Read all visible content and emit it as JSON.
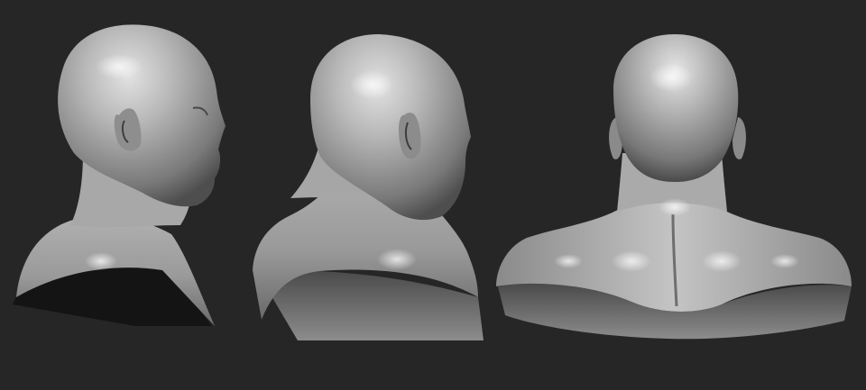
{
  "scene": {
    "background_color": "#262626",
    "material_color": "#b4b4b4",
    "highlight_color": "#e6e6e6",
    "shadow_color": "#505050",
    "cavity_color": "#3a3a3a",
    "views": [
      {
        "name": "side-view"
      },
      {
        "name": "three-quarter-back-view"
      },
      {
        "name": "back-view"
      }
    ]
  }
}
